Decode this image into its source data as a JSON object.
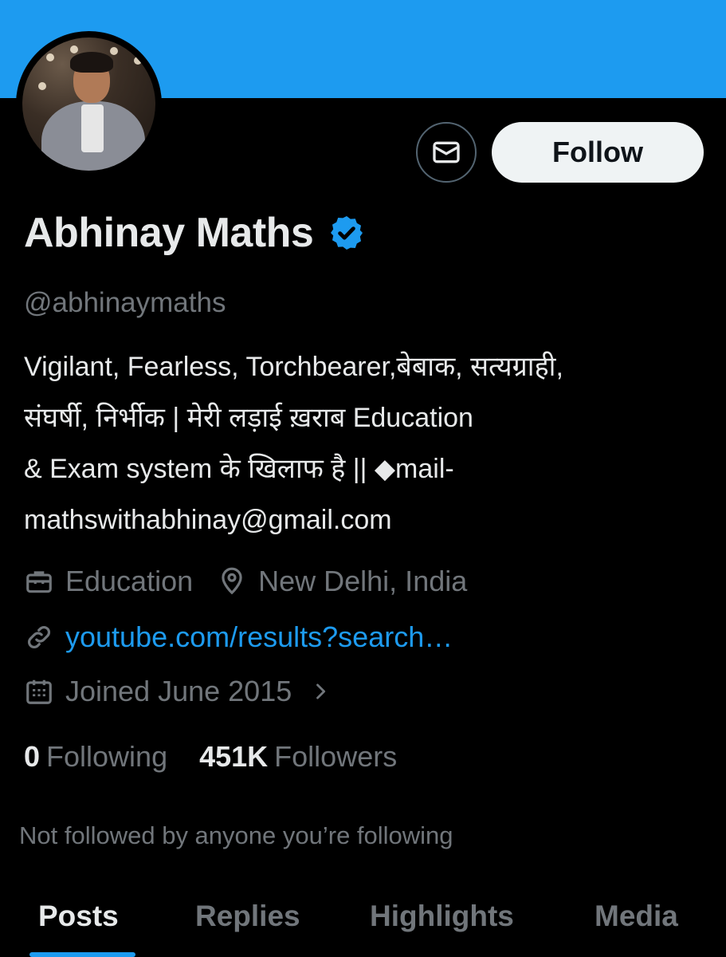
{
  "profile": {
    "name": "Abhinay Maths",
    "handle": "@abhinaymaths",
    "bio": "Vigilant, Fearless, Torchbearer,बेबाक, सत्यग्राही,\nसंघर्षी, निर्भीक | मेरी लड़ाई ख़राब Education\n& Exam system के खिलाफ है || ◆mail-\nmathswithabhinay@gmail.com",
    "category": "Education",
    "location": "New Delhi, India",
    "website": "youtube.com/results?search…",
    "joined": "Joined June 2015",
    "following_count": "0",
    "following_label": "Following",
    "followers_count": "451K",
    "followers_label": "Followers",
    "not_followed_text": "Not followed by anyone you’re following"
  },
  "actions": {
    "follow_label": "Follow"
  },
  "tabs": [
    {
      "label": "Posts",
      "active": true
    },
    {
      "label": "Replies",
      "active": false
    },
    {
      "label": "Highlights",
      "active": false
    },
    {
      "label": "Media",
      "active": false
    }
  ],
  "icons": {
    "message": "envelope-icon",
    "verified": "verified-badge-icon",
    "category": "briefcase-icon",
    "location": "location-pin-icon",
    "link": "link-icon",
    "joined": "calendar-icon",
    "chevron": "chevron-right-icon"
  },
  "colors": {
    "banner": "#1d9bf0",
    "accent": "#1d9bf0",
    "background": "#000000",
    "primary_text": "#e7e9ea",
    "secondary_text": "#71767b",
    "follow_button_bg": "#eff3f4"
  }
}
